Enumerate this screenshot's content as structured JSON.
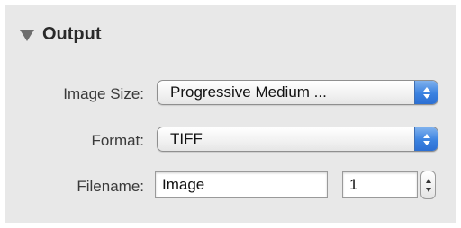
{
  "section": {
    "title": "Output"
  },
  "image_size": {
    "label": "Image Size:",
    "value": "Progressive Medium ..."
  },
  "format": {
    "label": "Format:",
    "value": "TIFF"
  },
  "filename": {
    "label": "Filename:",
    "name_value": "Image",
    "number_value": "1"
  },
  "colors": {
    "panel_background": "#e8e8e8",
    "popup_arrow_accent": "#3b82e0"
  },
  "icons": {
    "disclosure": "disclosure-triangle-down-icon",
    "popup_arrows": "up-down-arrows-icon",
    "stepper": "stepper-arrows-icon"
  }
}
